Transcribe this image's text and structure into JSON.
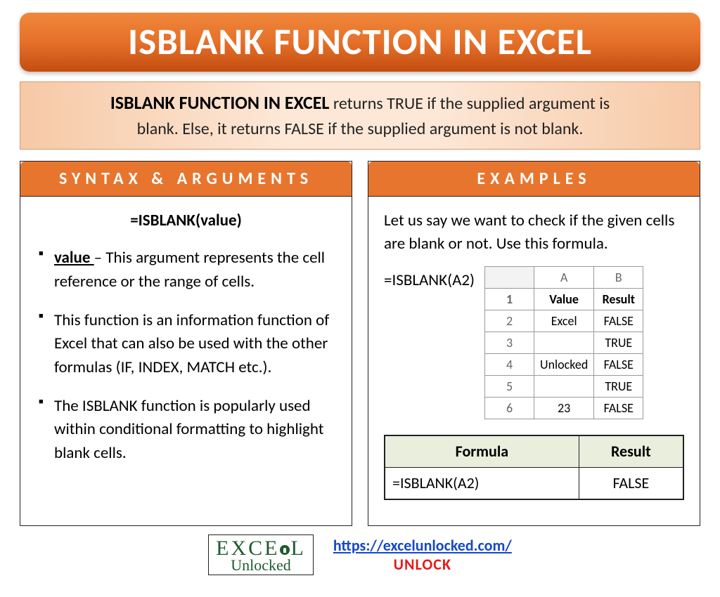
{
  "title": "ISBLANK FUNCTION IN EXCEL",
  "intro": {
    "lead": "ISBLANK FUNCTION IN EXCEL",
    "rest1": " returns TRUE if the supplied argument is",
    "rest2": "blank. Else, it returns FALSE if the supplied argument is not blank."
  },
  "syntax": {
    "header": "SYNTAX & ARGUMENTS",
    "formula": "=ISBLANK(value)",
    "arg_label": "value ",
    "arg_desc": "– This argument represents the cell reference or the range of cells.",
    "bullet2": "This function is an information function of Excel that can also be used with the other formulas (IF, INDEX, MATCH etc.).",
    "bullet3": "The ISBLANK function is popularly used within conditional formatting to highlight blank cells."
  },
  "examples": {
    "header": "EXAMPLES",
    "intro": "Let us say we want to check if the given cells are blank or not. Use this formula.",
    "formula": "=ISBLANK(A2)",
    "sheet": {
      "cols": [
        "A",
        "B"
      ],
      "header_row": [
        "Value",
        "Result"
      ],
      "rows": [
        [
          "Excel",
          "FALSE"
        ],
        [
          "",
          "TRUE"
        ],
        [
          "Unlocked",
          "FALSE"
        ],
        [
          "",
          "TRUE"
        ],
        [
          "23",
          "FALSE"
        ]
      ]
    },
    "result_table": {
      "headers": [
        "Formula",
        "Result"
      ],
      "row": [
        "=ISBLANK(A2)",
        "FALSE"
      ]
    }
  },
  "footer": {
    "logo_top": "EXCE",
    "logo_top2": "L",
    "logo_bottom": "Unlocked",
    "url": "https://excelunlocked.com/",
    "tag": "UNLOCK"
  }
}
